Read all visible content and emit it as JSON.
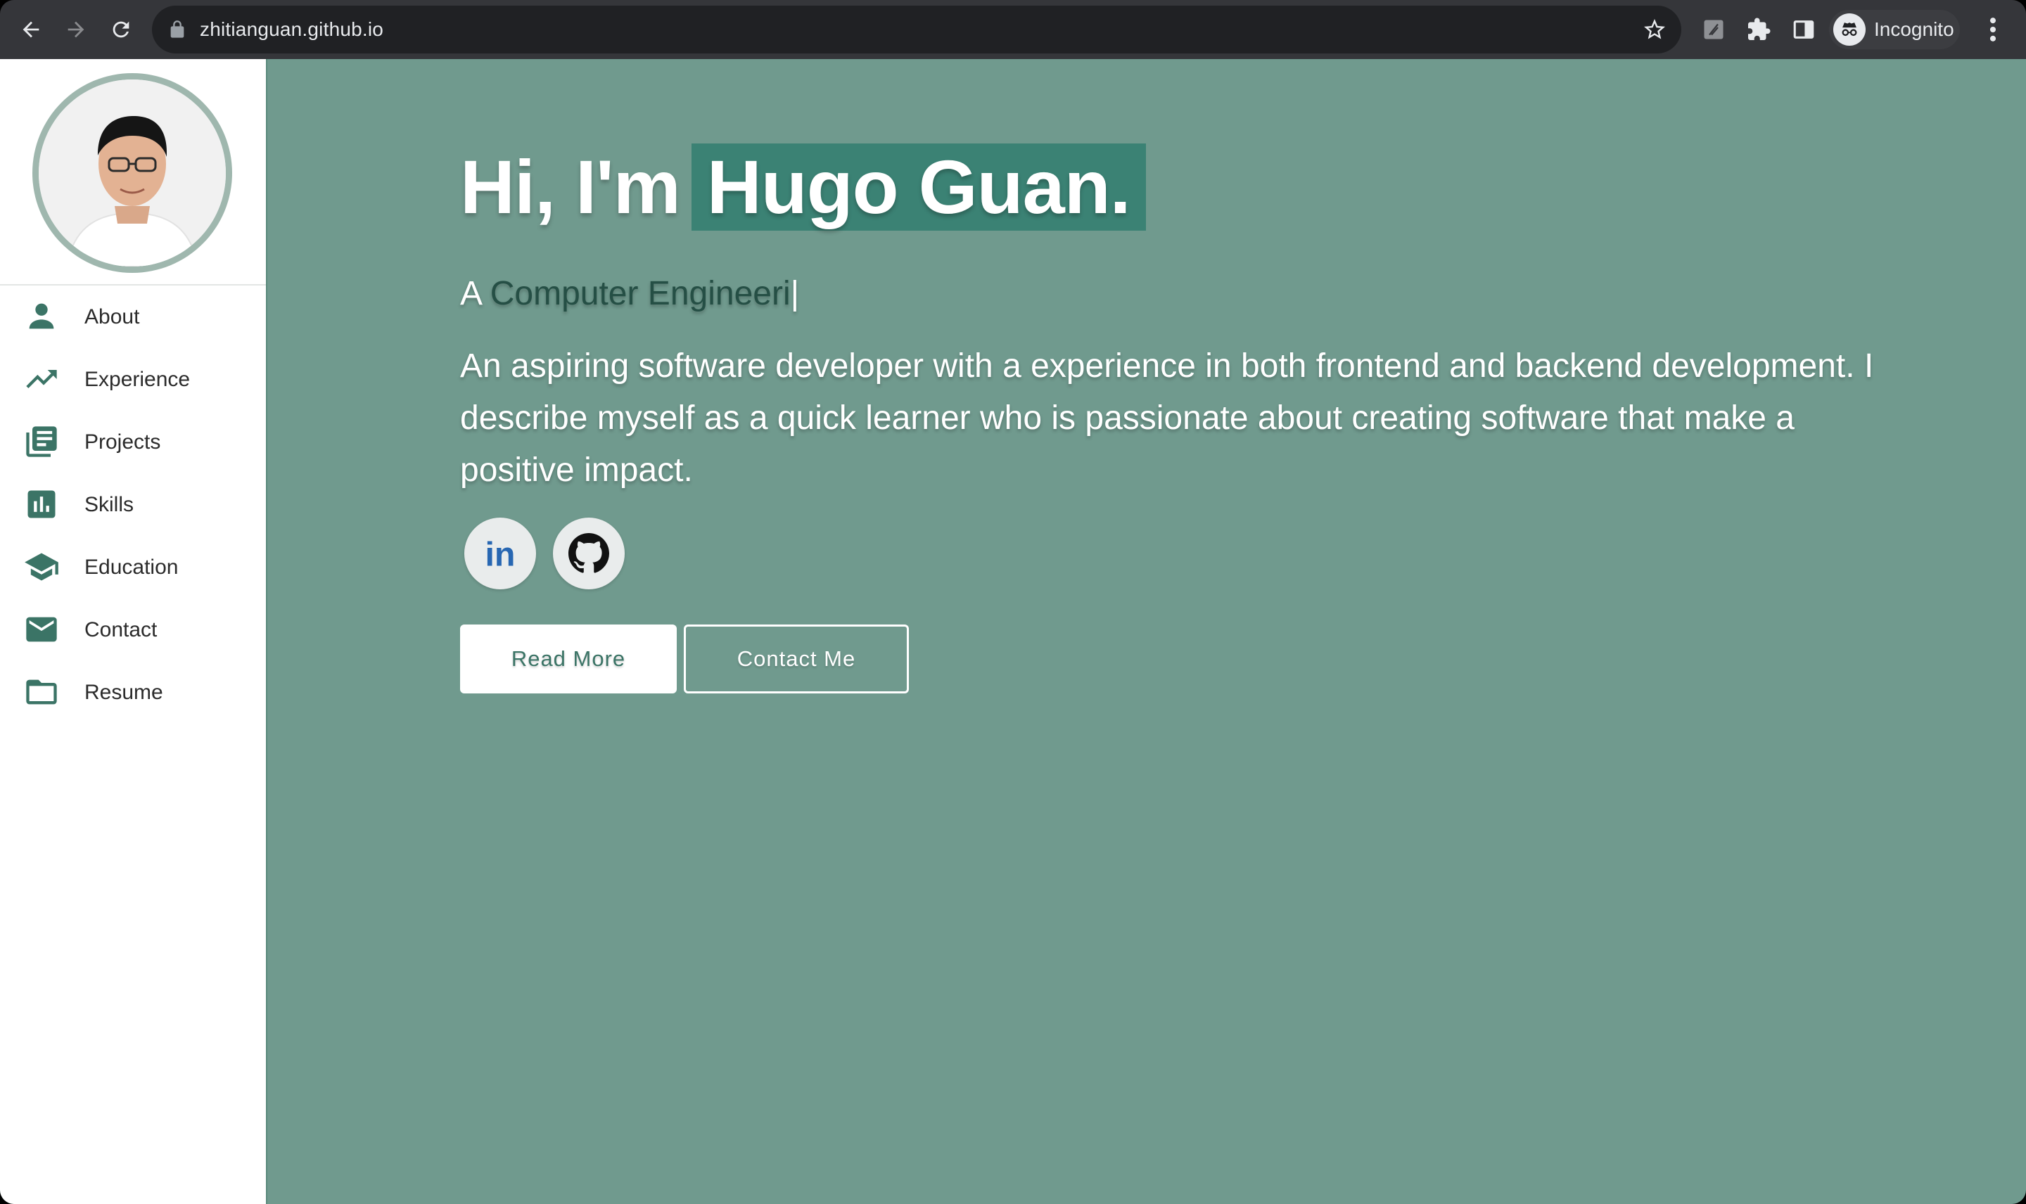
{
  "browser": {
    "url": "zhitianguan.github.io",
    "profile_label": "Incognito",
    "icons": [
      "back-icon",
      "forward-icon",
      "reload-icon",
      "lock-icon",
      "star-icon",
      "extension-icon",
      "puzzle-icon",
      "side-panel-icon",
      "incognito-icon",
      "menu-icon"
    ]
  },
  "colors": {
    "page_background": "#709a8e",
    "accent": "#3b8274",
    "sidebar_icon": "#3b7466",
    "typed_text": "#254f45"
  },
  "sidebar": {
    "items": [
      {
        "label": "About",
        "icon": "person-icon"
      },
      {
        "label": "Experience",
        "icon": "trending-up-icon"
      },
      {
        "label": "Projects",
        "icon": "library-books-icon"
      },
      {
        "label": "Skills",
        "icon": "bar-chart-icon"
      },
      {
        "label": "Education",
        "icon": "school-icon"
      },
      {
        "label": "Contact",
        "icon": "mail-icon"
      },
      {
        "label": "Resume",
        "icon": "folder-icon"
      }
    ]
  },
  "hero": {
    "greeting": "Hi, I'm",
    "name": "Hugo Guan.",
    "tagline_prefix": "A",
    "tagline_typed": "Computer Engineeri",
    "cursor": "|",
    "bio": "An aspiring software developer with a experience in both frontend and backend development. I describe myself as a quick learner who is passionate about creating software that make a positive impact.",
    "socials": [
      {
        "name": "linkedin",
        "label": "in"
      },
      {
        "name": "github"
      }
    ],
    "buttons": {
      "read_more": "Read More",
      "contact_me": "Contact Me"
    }
  }
}
